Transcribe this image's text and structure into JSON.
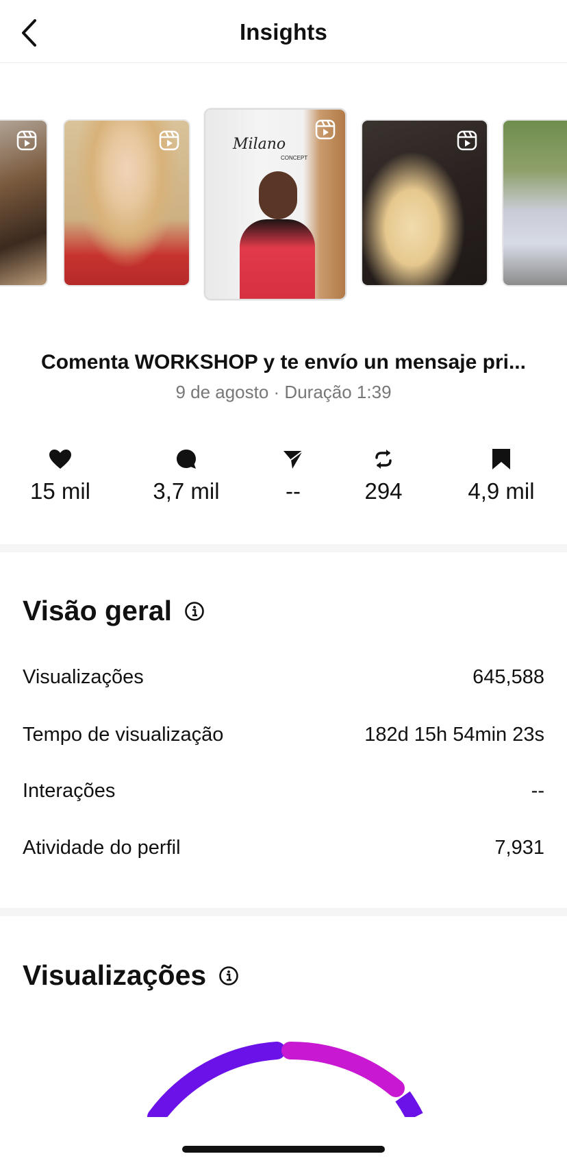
{
  "header": {
    "title": "Insights",
    "back_icon": "chevron-left-icon"
  },
  "carousel": {
    "items": [
      {
        "name": "reel-thumb-1",
        "icon": "reels-icon",
        "selected": false
      },
      {
        "name": "reel-thumb-2",
        "icon": "reels-icon",
        "selected": false
      },
      {
        "name": "reel-thumb-3",
        "icon": "reels-icon",
        "selected": true,
        "logo_text": "Milano",
        "logo_sub": "CONCEPT"
      },
      {
        "name": "reel-thumb-4",
        "icon": "reels-icon",
        "selected": false
      },
      {
        "name": "reel-thumb-5",
        "icon": "reels-icon",
        "selected": false
      }
    ]
  },
  "post": {
    "caption": "Comenta WORKSHOP y te envío un mensaje pri...",
    "meta": "9 de agosto · Duração 1:39"
  },
  "stats": [
    {
      "icon": "heart-icon",
      "value": "15 mil"
    },
    {
      "icon": "comment-icon",
      "value": "3,7 mil"
    },
    {
      "icon": "share-icon",
      "value": "--"
    },
    {
      "icon": "repost-icon",
      "value": "294"
    },
    {
      "icon": "bookmark-icon",
      "value": "4,9 mil"
    }
  ],
  "overview": {
    "title": "Visão geral",
    "rows": [
      {
        "label": "Visualizações",
        "value": "645,588"
      },
      {
        "label": "Tempo de visualização",
        "value": "182d 15h 54min 23s"
      },
      {
        "label": "Interações",
        "value": "--"
      },
      {
        "label": "Atividade do perfil",
        "value": "7,931"
      }
    ]
  },
  "views": {
    "title": "Visualizações"
  },
  "colors": {
    "gauge_purple": "#6a12e8",
    "gauge_magenta": "#c918d2",
    "text_secondary": "#777777"
  }
}
